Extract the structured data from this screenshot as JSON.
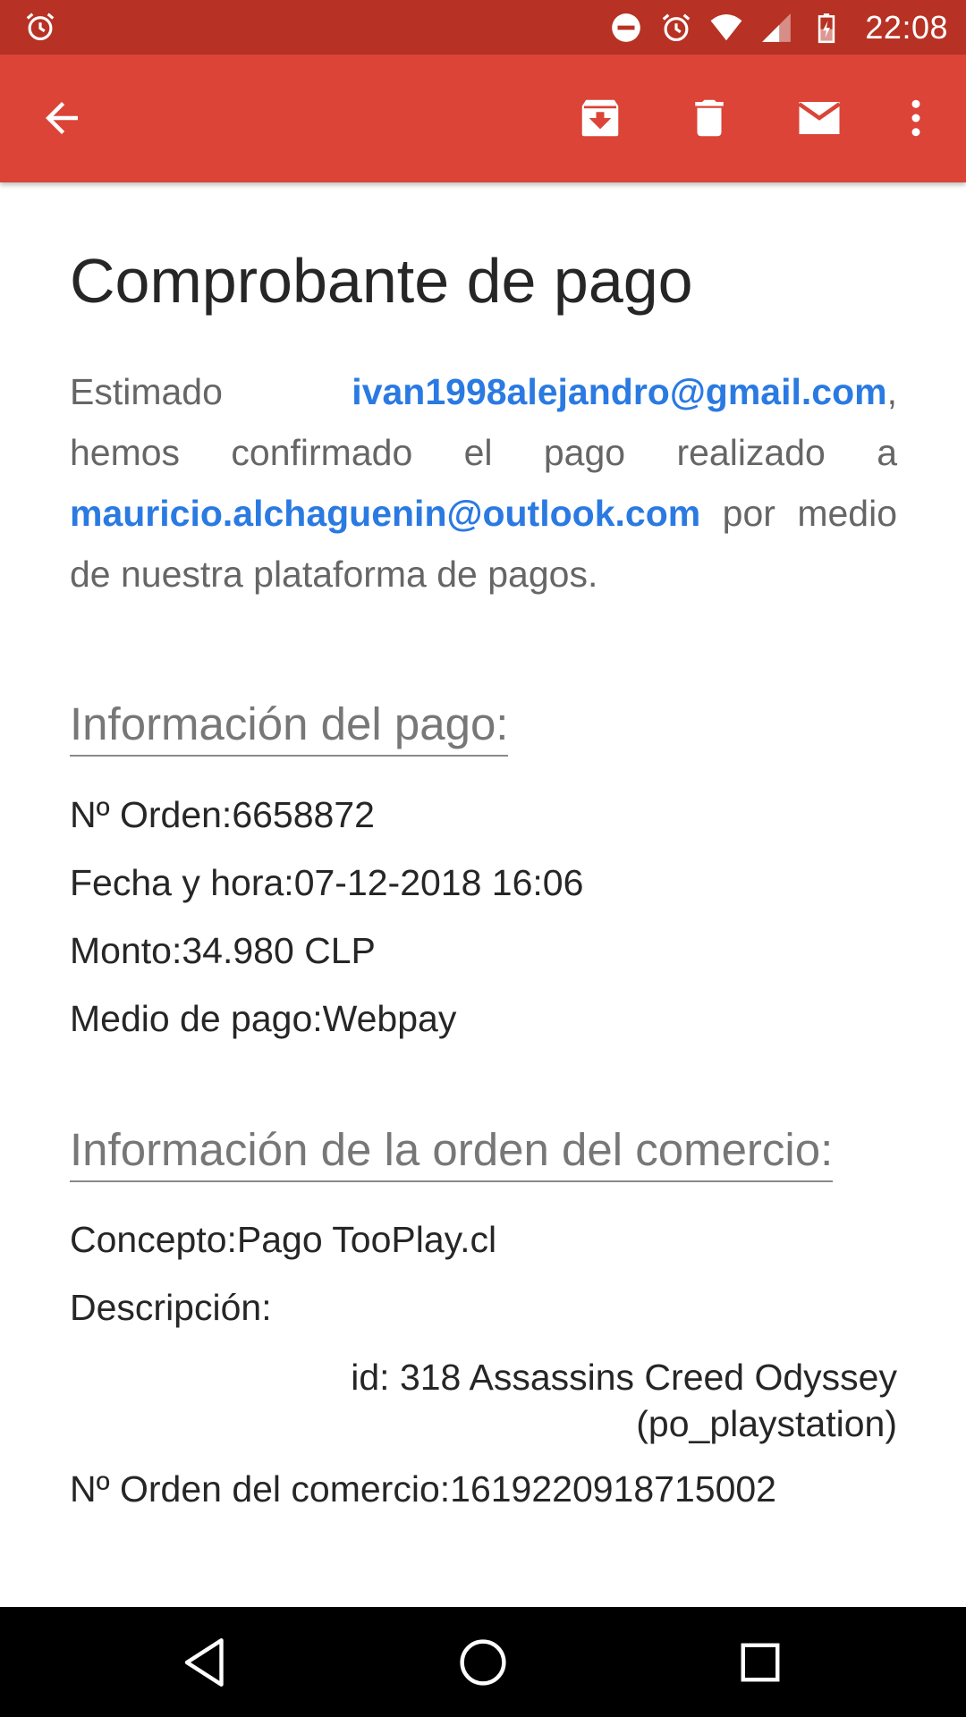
{
  "status_bar": {
    "time": "22:08",
    "left_icon": "alarm-icon",
    "right_icons": [
      "dnd-icon",
      "alarm-icon",
      "wifi-icon",
      "signal-icon",
      "battery-charging-icon"
    ]
  },
  "app_bar": {
    "back_icon": "arrow-back-icon",
    "actions": [
      "archive-icon",
      "delete-icon",
      "mark-unread-icon",
      "more-vert-icon"
    ],
    "color": "#db4437"
  },
  "email": {
    "title": "Comprobante de pago",
    "intro": {
      "greeting": "Estimado",
      "sender_email": "ivan1998alejandro@gmail.com",
      "comma": ",",
      "middle": "hemos confirmado el pago realizado a",
      "recipient_email": "mauricio.alchaguenin@outlook.com",
      "ending": "por medio de nuestra plataforma de pagos."
    },
    "payment_section": {
      "title": "Información del pago:",
      "order": {
        "label": "Nº Orden:",
        "value": "6658872"
      },
      "datetime": {
        "label": "Fecha y hora:",
        "value": "07-12-2018 16:06"
      },
      "amount": {
        "label": "Monto:",
        "value": "34.980 CLP"
      },
      "method": {
        "label": "Medio de pago:",
        "value": "Webpay"
      }
    },
    "merchant_section": {
      "title": "Información de la orden del comercio:",
      "concept": {
        "label": "Concepto:",
        "value": "Pago TooPlay.cl"
      },
      "description_label": "Descripción:",
      "description_line1": "id: 318 Assassins Creed Odyssey",
      "description_line2": "(po_playstation)",
      "merchant_order": {
        "label": "Nº Orden del comercio:",
        "value": "1619220918715002"
      }
    },
    "link_color": "#2a7ae2"
  },
  "nav_bar": {
    "buttons": [
      "back-triangle-icon",
      "home-circle-icon",
      "recents-square-icon"
    ]
  }
}
